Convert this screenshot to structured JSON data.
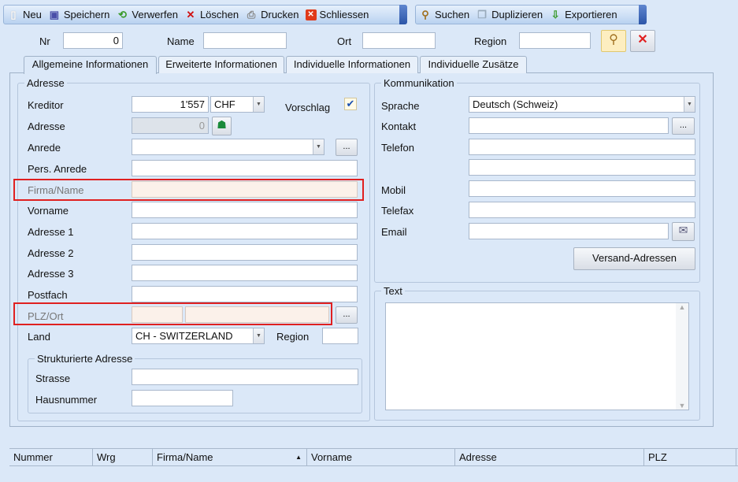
{
  "toolbar": {
    "items": [
      {
        "label": "Neu",
        "icon": "new-document-icon"
      },
      {
        "label": "Speichern",
        "icon": "save-icon"
      },
      {
        "label": "Verwerfen",
        "icon": "discard-icon"
      },
      {
        "label": "Löschen",
        "icon": "delete-x-icon"
      },
      {
        "label": "Drucken",
        "icon": "printer-icon"
      },
      {
        "label": "Schliessen",
        "icon": "close-red-icon"
      }
    ],
    "items2": [
      {
        "label": "Suchen",
        "icon": "search-icon"
      },
      {
        "label": "Duplizieren",
        "icon": "duplicate-icon"
      },
      {
        "label": "Exportieren",
        "icon": "export-icon"
      }
    ]
  },
  "search": {
    "nr_label": "Nr",
    "nr_value": "0",
    "name_label": "Name",
    "name_value": "",
    "ort_label": "Ort",
    "ort_value": "",
    "region_label": "Region",
    "region_value": ""
  },
  "tabs": [
    "Allgemeine Informationen",
    "Erweiterte Informationen",
    "Individuelle Informationen",
    "Individuelle Zusätze"
  ],
  "adresse": {
    "title": "Adresse",
    "kreditor_label": "Kreditor",
    "kreditor_value": "1'557",
    "currency": "CHF",
    "vorschlag_label": "Vorschlag",
    "vorschlag_checked": true,
    "adresse_label": "Adresse",
    "adresse_value": "0",
    "anrede_label": "Anrede",
    "pers_anrede_label": "Pers. Anrede",
    "firma_label": "Firma/Name",
    "vorname_label": "Vorname",
    "adresse1_label": "Adresse 1",
    "adresse2_label": "Adresse 2",
    "adresse3_label": "Adresse 3",
    "postfach_label": "Postfach",
    "plz_label": "PLZ/Ort",
    "land_label": "Land",
    "land_value": "CH - SWITZERLAND",
    "region_label": "Region",
    "ellipsis": "...",
    "struct_title": "Strukturierte Adresse",
    "strasse_label": "Strasse",
    "hausnummer_label": "Hausnummer"
  },
  "komm": {
    "title": "Kommunikation",
    "sprache_label": "Sprache",
    "sprache_value": "Deutsch (Schweiz)",
    "kontakt_label": "Kontakt",
    "telefon_label": "Telefon",
    "mobil_label": "Mobil",
    "telefax_label": "Telefax",
    "email_label": "Email",
    "versand_label": "Versand-Adressen"
  },
  "text": {
    "title": "Text"
  },
  "grid": {
    "columns": [
      "Nummer",
      "Wrg",
      "Firma/Name",
      "Vorname",
      "Adresse",
      "PLZ"
    ],
    "sort_indicator": "▲"
  }
}
